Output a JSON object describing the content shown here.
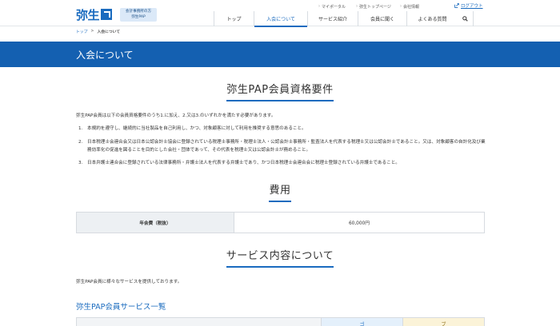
{
  "header": {
    "logo_text": "弥生",
    "badge_line1": "会計事務所の方",
    "badge_line2": "弥生PAP",
    "utility_links": [
      "マイポータル",
      "弥生トップページ",
      "会社情報"
    ],
    "logout_label": "ログアウト",
    "nav": [
      {
        "label": "トップ",
        "active": false
      },
      {
        "label": "入会について",
        "active": true
      },
      {
        "label": "サービス紹介",
        "active": false
      },
      {
        "label": "会員に聞く",
        "active": false
      },
      {
        "label": "よくある質問",
        "active": false
      }
    ]
  },
  "breadcrumb": {
    "home": "トップ",
    "separator": ">",
    "current": "入会について"
  },
  "banner": {
    "title": "入会について"
  },
  "requirements": {
    "heading": "弥生PAP会員資格要件",
    "intro": "弥生PAP会員は以下の会員資格要件のうち1.に加え、2.又は3.のいずれかを満たす必要があります。",
    "items": [
      {
        "num": "1.",
        "text": "本規約を遵守し、継続的に当社製品を自己利用し、かつ、対象顧客に対して利用を推奨する意思のあること。"
      },
      {
        "num": "2.",
        "text": "日本税理士会連合会又は日本公認会計士協会に登録されている税理士事務所・税理士法人・公認会計士事務所・監査法人を代表する税理士又は公認会計士であること。又は、対象顧客の自計化及び業務効率化の促進を図ることを目的とした会社・団体であって、その代表を税理士又は公認会計士が務めること。"
      },
      {
        "num": "3.",
        "text": "日本弁護士連合会に登録されている法律事務所・弁護士法人を代表する弁護士であり、かつ日本税理士会連合会に税理士登録されている弁護士であること。"
      }
    ]
  },
  "fee": {
    "heading": "費用",
    "row_label": "年会費（税抜）",
    "row_value": "60,000円"
  },
  "services": {
    "heading": "サービス内容について",
    "intro": "弥生PAP会員に様々なサービスを提供しております。",
    "list_title": "弥生PAP会員サービス一覧",
    "col2_partial": "ゴ",
    "col3_partial": "ブ"
  },
  "colors": {
    "brand_blue": "#1460b1",
    "link_blue": "#1a6bbf"
  },
  "icons": [
    "search-icon",
    "chevron-right-icon",
    "external-link-icon"
  ]
}
